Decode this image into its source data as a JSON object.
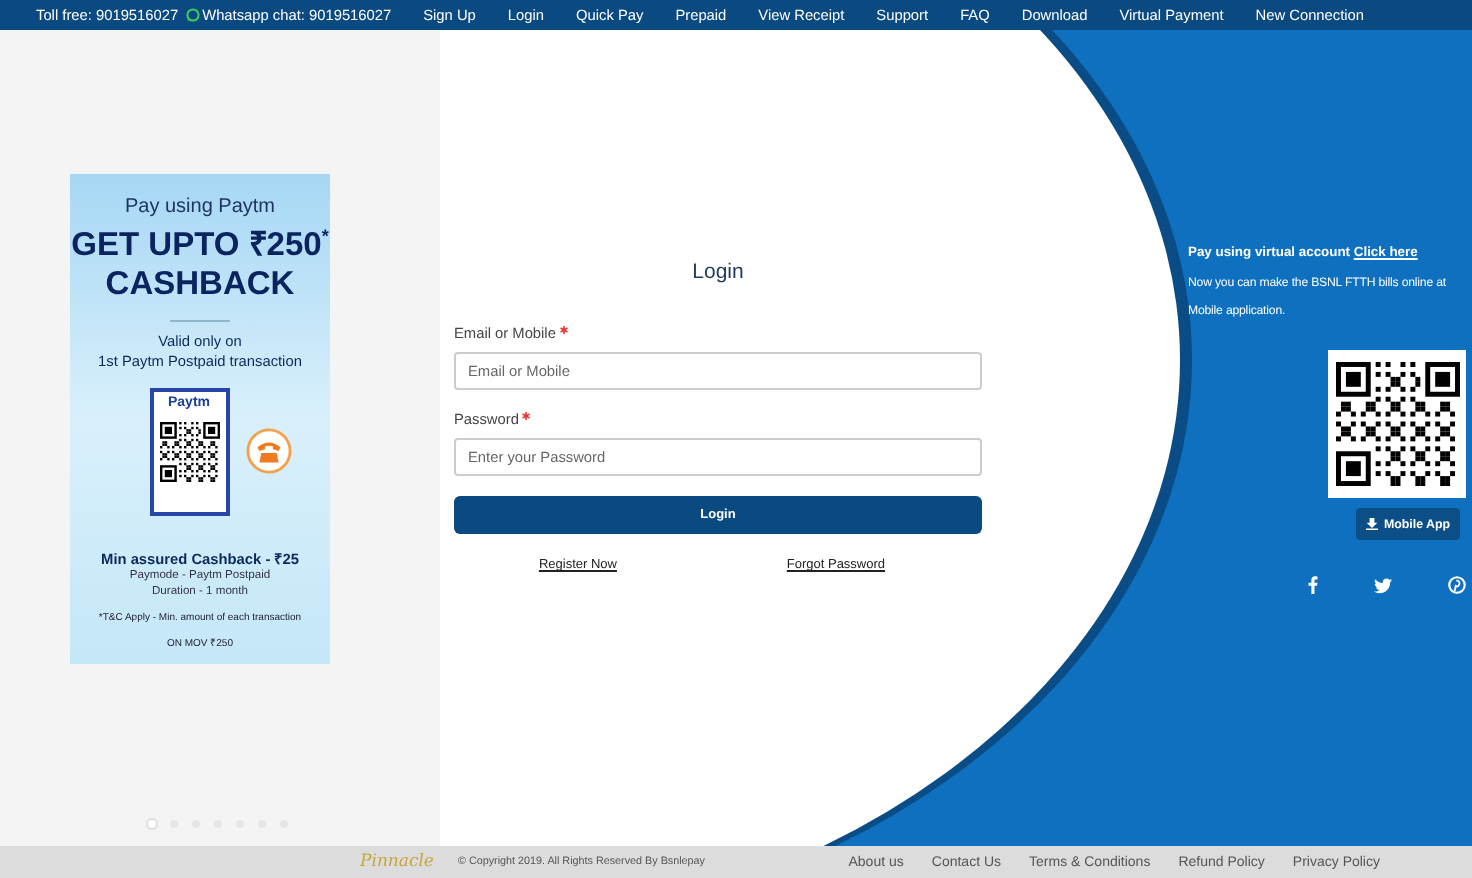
{
  "top_bar": {
    "toll_free": "Toll free: 9019516027",
    "whatsapp": "Whatsapp chat: 9019516027",
    "nav": [
      {
        "label": "Sign Up"
      },
      {
        "label": "Login"
      },
      {
        "label": "Quick Pay"
      },
      {
        "label": "Prepaid"
      },
      {
        "label": "View Receipt"
      },
      {
        "label": "Support"
      },
      {
        "label": "FAQ"
      },
      {
        "label": "Download"
      },
      {
        "label": "Virtual Payment"
      },
      {
        "label": "New Connection"
      }
    ]
  },
  "promo_banner": {
    "headline": "Pay using Paytm",
    "offer": "GET UPTO ₹250$^{*}$",
    "offer_2": "CASHBACK",
    "valid": "Valid only on",
    "valid_2": "1st Paytm Postpaid transaction",
    "card_logo": "Paytm",
    "min_cashback": "Min assured Cashback - ₹25",
    "paymode": "Paymode - Paytm Postpaid",
    "duration": "Duration - 1 month",
    "terms": "*T&C Apply - Min. amount of each transaction",
    "terms_2": "ON MOV ₹250"
  },
  "carousel_dots": [
    {
      "selected": true
    },
    {
      "selected": false
    },
    {
      "selected": false
    },
    {
      "selected": false
    },
    {
      "selected": false
    },
    {
      "selected": false
    },
    {
      "selected": false
    }
  ],
  "login": {
    "title": "Login",
    "fields": [
      {
        "label": "Email or Mobile",
        "required": true,
        "placeholder": "Email or Mobile"
      },
      {
        "label": "Password",
        "required": true,
        "placeholder": "Enter your Password"
      }
    ],
    "button": "Login",
    "links": [
      "Register Now",
      "Forgot Password"
    ]
  },
  "right_panel": {
    "virtual_text": "Pay using virtual account",
    "virtual_link": "Click here",
    "lines": [
      "Now you can make the BSNL FTTH bills online at",
      "Mobile application."
    ],
    "app_button": "Mobile App"
  },
  "footer": {
    "brand": "Pinnacle",
    "copyright": "© Copyright 2019. All Rights Reserved By Bsnlepay",
    "links": [
      "About us",
      "Contact Us",
      "Terms & Conditions",
      "Refund Policy",
      "Privacy Policy"
    ]
  }
}
